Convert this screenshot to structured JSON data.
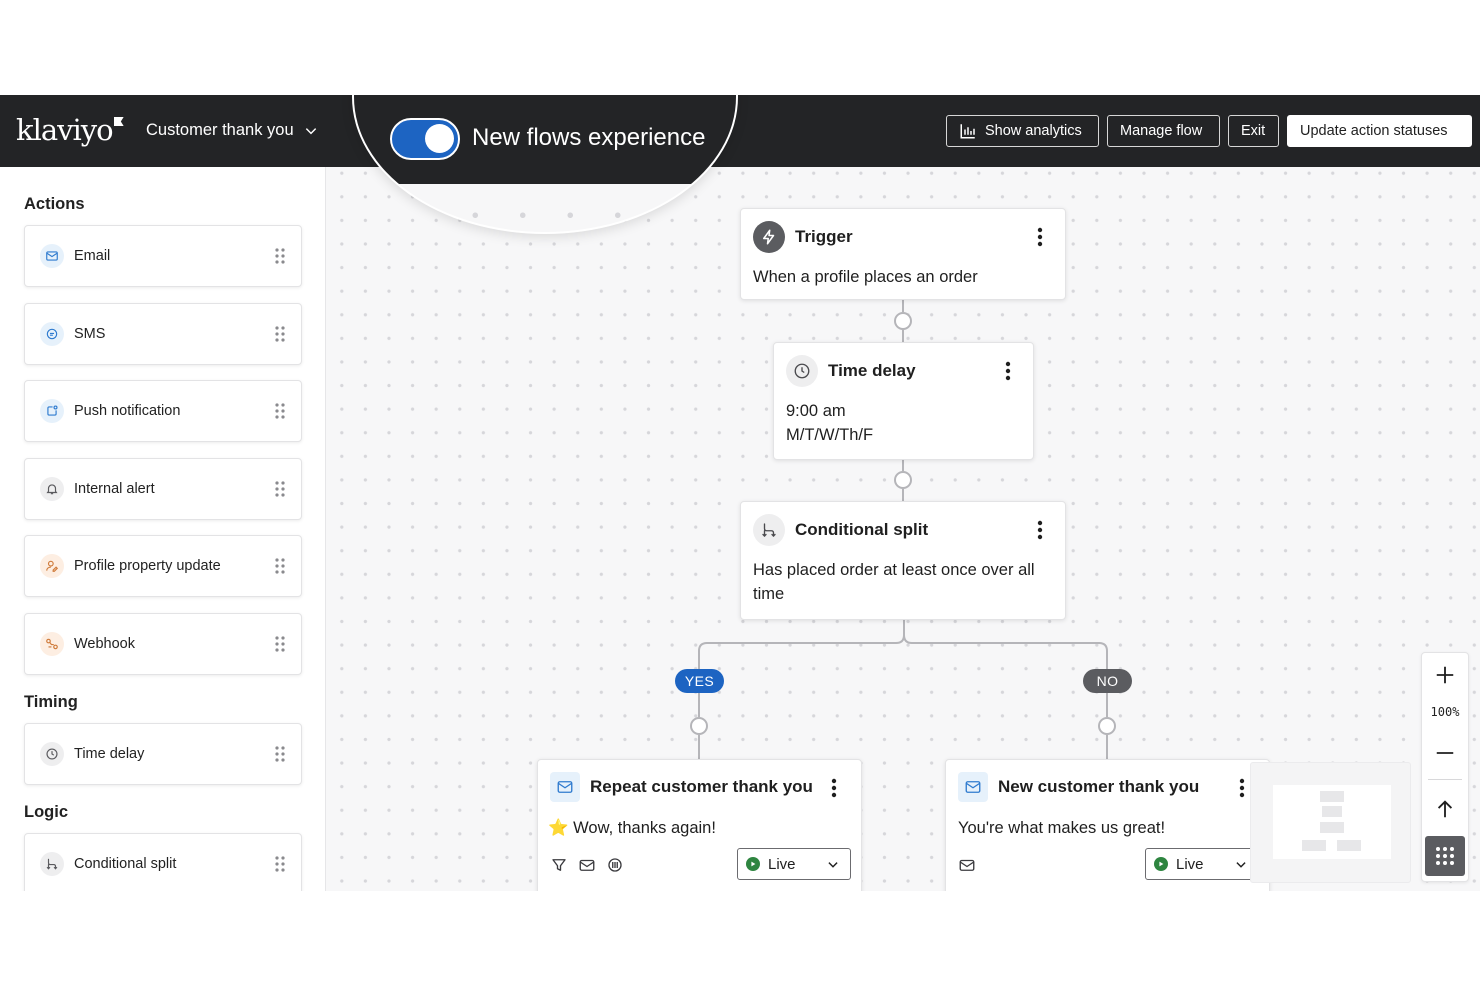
{
  "topbar": {
    "logo_text": "klaviyo",
    "flow_name": "Customer thank you",
    "show_analytics": "Show analytics",
    "manage_flow": "Manage flow",
    "exit": "Exit",
    "update_statuses": "Update action statuses"
  },
  "feature_toggle": {
    "label": "New flows experience",
    "enabled": true
  },
  "sidebar": {
    "actions_title": "Actions",
    "actions": [
      {
        "label": "Email",
        "icon": "email-icon"
      },
      {
        "label": "SMS",
        "icon": "sms-icon"
      },
      {
        "label": "Push notification",
        "icon": "push-notification-icon"
      },
      {
        "label": "Internal alert",
        "icon": "bell-icon"
      },
      {
        "label": "Profile property update",
        "icon": "profile-icon"
      },
      {
        "label": "Webhook",
        "icon": "webhook-icon"
      }
    ],
    "timing_title": "Timing",
    "timing": [
      {
        "label": "Time delay",
        "icon": "clock-icon"
      }
    ],
    "logic_title": "Logic",
    "logic": [
      {
        "label": "Conditional split",
        "icon": "split-icon"
      }
    ]
  },
  "flow": {
    "trigger": {
      "title": "Trigger",
      "description": "When a profile places an order"
    },
    "delay": {
      "title": "Time delay",
      "line1": "9:00 am",
      "line2": "M/T/W/Th/F"
    },
    "split": {
      "title": "Conditional split",
      "line1": "Has placed order at least once over all",
      "line2": "time"
    },
    "yes_label": "YES",
    "no_label": "NO",
    "email_yes": {
      "title": "Repeat customer thank you",
      "emoji": "⭐",
      "subject": "Wow, thanks again!",
      "status": "Live"
    },
    "email_no": {
      "title": "New customer thank you",
      "subject": "You're what makes us great!",
      "status": "Live"
    }
  },
  "zoom": {
    "level": "100%"
  },
  "colors": {
    "topbar": "#232426",
    "accent_blue": "#1d64c2",
    "yes_pill": "#1d64c2",
    "no_pill": "#5b5c60",
    "live_green": "#2e8540"
  }
}
